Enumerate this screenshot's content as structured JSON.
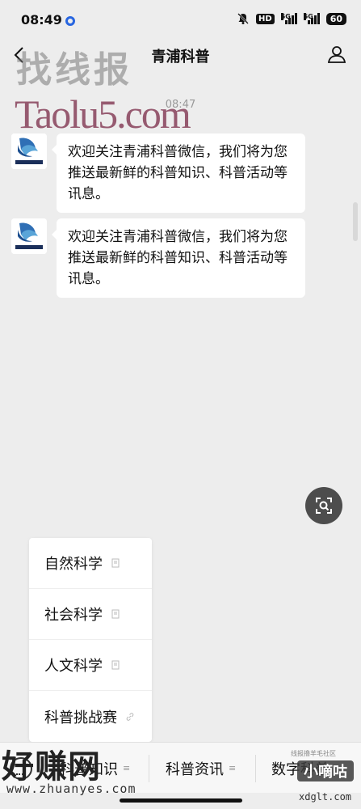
{
  "status_bar": {
    "time": "08:49",
    "hd": "HD",
    "sig1": "5G",
    "sig2": "5G",
    "battery": "60"
  },
  "nav": {
    "title": "青浦科普"
  },
  "watermarks": {
    "top_chinese": "找线报",
    "top_latin": "Taolu5.com",
    "bottom_chinese": "好赚网",
    "bottom_url": "www.zhuanyes.com",
    "bottom_right_badge": "小嘀咕",
    "bottom_right_url": "xdglt.com",
    "bottom_right_tiny": "线报撸羊毛社区"
  },
  "chat": {
    "timestamp": "08:47",
    "messages": [
      {
        "text": "欢迎关注青浦科普微信，我们将为您推送最新鲜的科普知识、科普活动等讯息。"
      },
      {
        "text": "欢迎关注青浦科普微信，我们将为您推送最新鲜的科普知识、科普活动等讯息。"
      }
    ]
  },
  "popup_menu": {
    "items": [
      {
        "label": "自然科学",
        "icon": "doc-icon"
      },
      {
        "label": "社会科学",
        "icon": "doc-icon"
      },
      {
        "label": "人文科学",
        "icon": "doc-icon"
      },
      {
        "label": "科普挑战赛",
        "icon": "link-icon"
      }
    ]
  },
  "bottom_menu": {
    "tabs": [
      {
        "label": "科普知识"
      },
      {
        "label": "科普资讯"
      },
      {
        "label": "数字科普"
      }
    ]
  },
  "colors": {
    "background": "#ededed",
    "bubble": "#ffffff",
    "status_dot": "#2866e0",
    "scan_button": "#4d4d4d"
  }
}
